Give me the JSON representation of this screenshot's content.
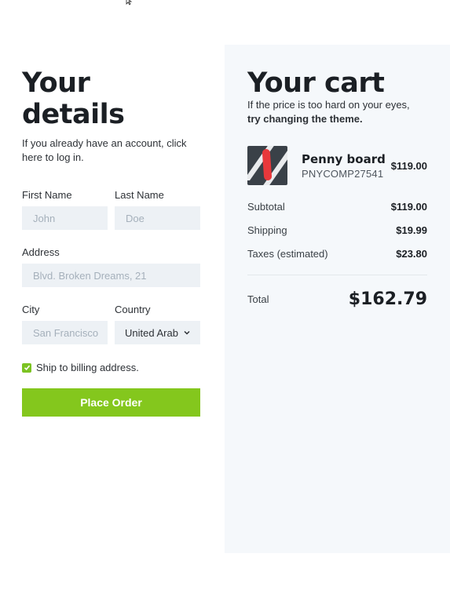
{
  "details": {
    "title": "Your details",
    "subtitle": "If you already have an account, click here to log in.",
    "first_name": {
      "label": "First Name",
      "placeholder": "John"
    },
    "last_name": {
      "label": "Last Name",
      "placeholder": "Doe"
    },
    "address": {
      "label": "Address",
      "placeholder": "Blvd. Broken Dreams, 21"
    },
    "city": {
      "label": "City",
      "placeholder": "San Francisco"
    },
    "country": {
      "label": "Country",
      "value": "United Arab"
    },
    "ship_label": "Ship to billing address.",
    "ship_checked": true,
    "place_order": "Place Order"
  },
  "cart": {
    "title": "Your cart",
    "subtitle_plain": "If the price is too hard on your eyes,",
    "subtitle_bold": "try changing the theme.",
    "item": {
      "name": "Penny board",
      "sku": "PNYCOMP27541",
      "price": "$119.00"
    },
    "subtotal": {
      "label": "Subtotal",
      "value": "$119.00"
    },
    "shipping": {
      "label": "Shipping",
      "value": "$19.99"
    },
    "taxes": {
      "label": "Taxes (estimated)",
      "value": "$23.80"
    },
    "total": {
      "label": "Total",
      "value": "$162.79"
    }
  },
  "colors": {
    "accent": "#84c71d",
    "panel": "#f5f8fb",
    "input_bg": "#edf1f5"
  }
}
